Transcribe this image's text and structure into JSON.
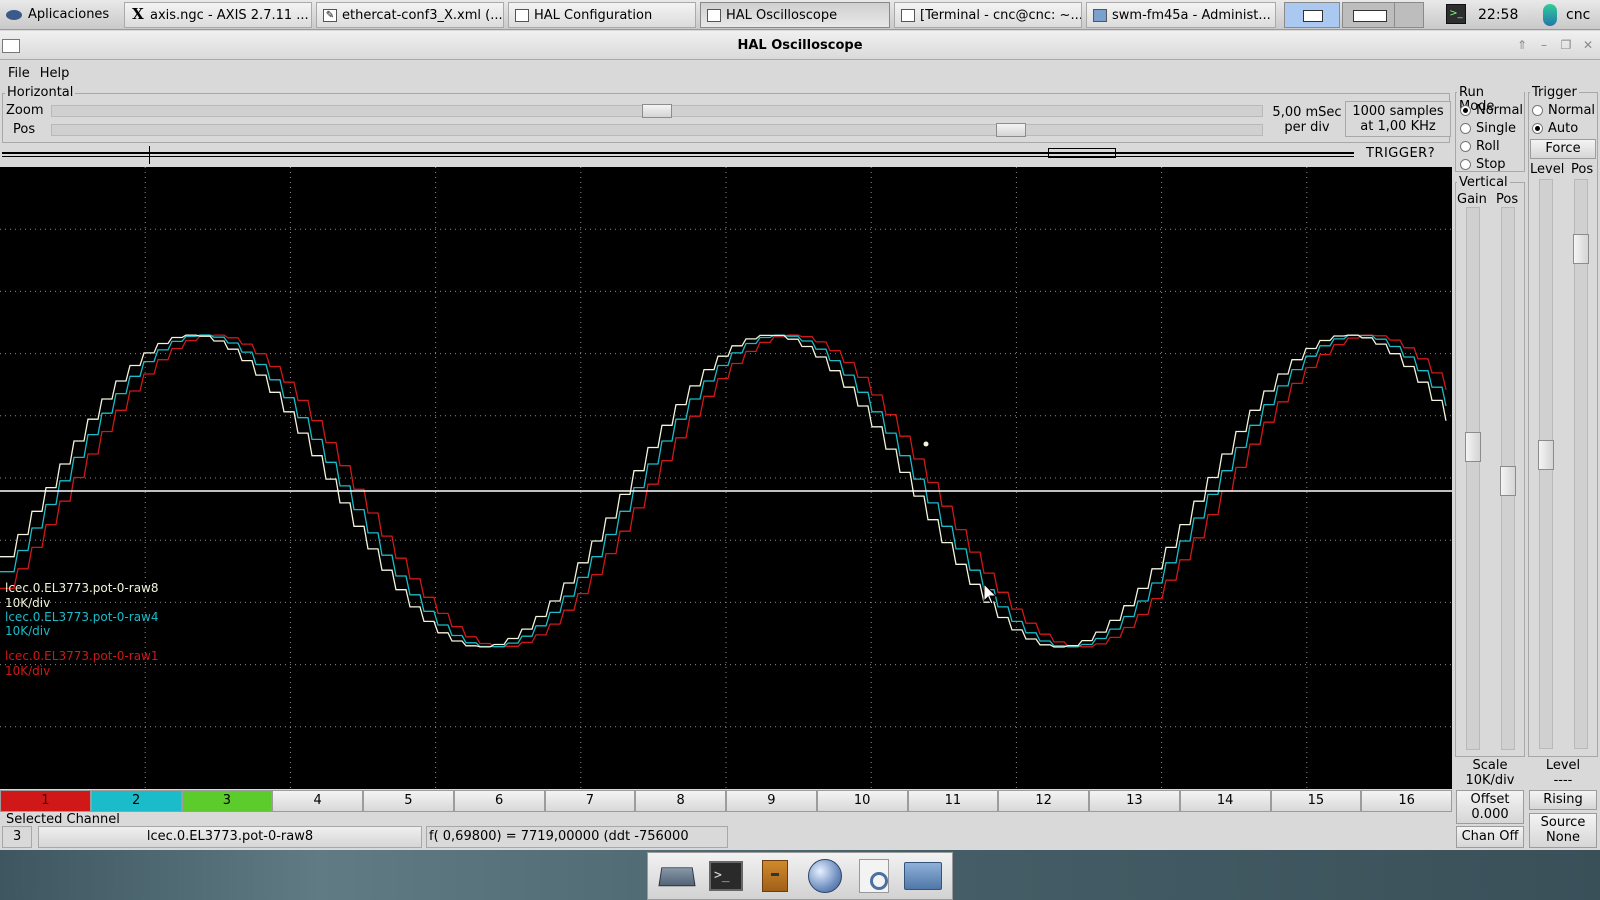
{
  "taskbar": {
    "apps_label": "Aplicaciones",
    "tasks": [
      {
        "label": "axis.ngc - AXIS 2.7.11 ..."
      },
      {
        "label": "ethercat-conf3_X.xml (..."
      },
      {
        "label": "HAL Configuration"
      },
      {
        "label": "HAL Oscilloscope"
      },
      {
        "label": "[Terminal - cnc@cnc: ~..."
      },
      {
        "label": "swm-fm45a - Administ..."
      }
    ],
    "clock": "22:58",
    "user": "cnc"
  },
  "window": {
    "title": "HAL Oscilloscope"
  },
  "menu": {
    "file": "File",
    "help": "Help"
  },
  "horizontal": {
    "frame_label": "Horizontal",
    "zoom_label": "Zoom",
    "pos_label": "Pos",
    "zoom_fraction": 0.5,
    "pos_fraction": 0.8,
    "timebase": "5,00 mSec",
    "timebase_unit": "per div",
    "samples": "1000 samples",
    "rate": "at 1,00 KHz",
    "trigger_state": "TRIGGER?"
  },
  "traces": [
    {
      "name": "lcec.0.EL3773.pot-0-raw8",
      "scale": "10K/div",
      "color": "#f4f4dc"
    },
    {
      "name": "lcec.0.EL3773.pot-0-raw4",
      "scale": "10K/div",
      "color": "#19bcc8"
    },
    {
      "name": "lcec.0.EL3773.pot-0-raw1",
      "scale": "10K/div",
      "color": "#d01818"
    }
  ],
  "channels": [
    {
      "label": "1",
      "color": "#d01818"
    },
    {
      "label": "2",
      "color": "#19bcc8"
    },
    {
      "label": "3",
      "color": "#5ccc2c"
    },
    {
      "label": "4"
    },
    {
      "label": "5"
    },
    {
      "label": "6"
    },
    {
      "label": "7"
    },
    {
      "label": "8"
    },
    {
      "label": "9"
    },
    {
      "label": "10"
    },
    {
      "label": "11"
    },
    {
      "label": "12"
    },
    {
      "label": "13"
    },
    {
      "label": "14"
    },
    {
      "label": "15"
    },
    {
      "label": "16"
    }
  ],
  "selected": {
    "label": "Selected Channel",
    "number": "3",
    "name": "lcec.0.EL3773.pot-0-raw8",
    "readout": "f( 0,69800) =   7719,00000 (ddt -756000"
  },
  "run_mode": {
    "label": "Run Mode",
    "options": [
      {
        "label": "Normal",
        "selected": true
      },
      {
        "label": "Single",
        "selected": false
      },
      {
        "label": "Roll",
        "selected": false
      },
      {
        "label": "Stop",
        "selected": false
      }
    ]
  },
  "trigger": {
    "label": "Trigger",
    "options": [
      {
        "label": "Normal",
        "selected": false
      },
      {
        "label": "Auto",
        "selected": true
      }
    ],
    "force_label": "Force",
    "level_label": "Level",
    "pos_label": "Pos",
    "level_caption": "Level",
    "level_value": "----",
    "edge_label": "Rising",
    "source_label": "Source",
    "source_value": "None"
  },
  "vertical": {
    "label": "Vertical",
    "gain_label": "Gain",
    "pos_label": "Pos",
    "scale_label": "Scale",
    "scale_value": "10K/div",
    "offset_label": "Offset",
    "offset_value": "0.000",
    "chan_off_label": "Chan Off"
  }
}
